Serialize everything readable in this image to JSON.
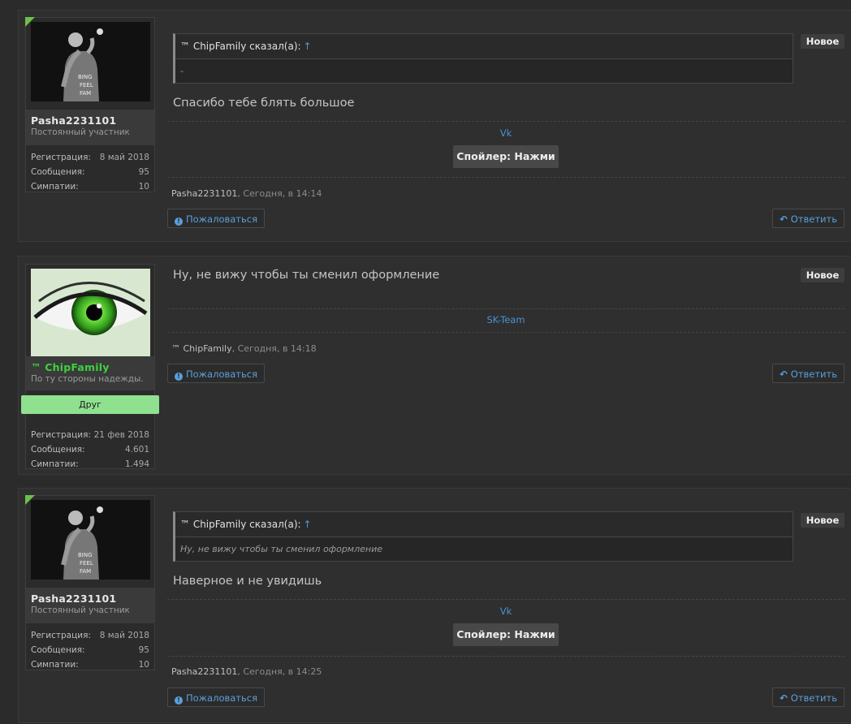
{
  "posts": [
    {
      "user": {
        "name": "Pasha2231101",
        "title": "Постоянный участник",
        "banner": "",
        "stats": [
          {
            "label": "Регистрация:",
            "value": "8 май 2018"
          },
          {
            "label": "Сообщения:",
            "value": "95"
          },
          {
            "label": "Симпатии:",
            "value": "10"
          }
        ]
      },
      "quote": {
        "author": "™ ChipFamily сказал(а):",
        "arrow": "↑",
        "text": "-"
      },
      "message": "Спасибо тебе блять большое",
      "badge": "Новое",
      "signature_link": "Vk",
      "spoiler": "Спойлер: Нажми",
      "meta_author": "Pasha2231101",
      "meta_time": ", Сегодня, в 14:14",
      "report": "Пожаловаться",
      "reply": "Ответить"
    },
    {
      "user": {
        "name": "™ ChipFamily",
        "title": "По ту стороны надежды.",
        "banner": "Друг",
        "stats": [
          {
            "label": "Регистрация:",
            "value": "21 фев 2018"
          },
          {
            "label": "Сообщения:",
            "value": "4.601"
          },
          {
            "label": "Симпатии:",
            "value": "1.494"
          }
        ]
      },
      "message": "Ну, не вижу чтобы ты сменил оформление",
      "badge": "Новое",
      "signature_link": "SK-Team",
      "meta_author": "™ ChipFamily",
      "meta_time": ", Сегодня, в 14:18",
      "report": "Пожаловаться",
      "reply": "Ответить"
    },
    {
      "user": {
        "name": "Pasha2231101",
        "title": "Постоянный участник",
        "banner": "",
        "stats": [
          {
            "label": "Регистрация:",
            "value": "8 май 2018"
          },
          {
            "label": "Сообщения:",
            "value": "95"
          },
          {
            "label": "Симпатии:",
            "value": "10"
          }
        ]
      },
      "quote": {
        "author": "™ ChipFamily сказал(а):",
        "arrow": "↑",
        "text": "Ну, не вижу чтобы ты сменил оформление"
      },
      "message": "Наверное и не увидишь",
      "badge": "Новое",
      "signature_link": "Vk",
      "spoiler": "Спойлер: Нажми",
      "meta_author": "Pasha2231101",
      "meta_time": ", Сегодня, в 14:25",
      "report": "Пожаловаться",
      "reply": "Ответить"
    }
  ],
  "colors": {
    "accent_link": "#4a92d0",
    "friend_banner": "#8fe08f",
    "username_green": "#3cd23c"
  }
}
